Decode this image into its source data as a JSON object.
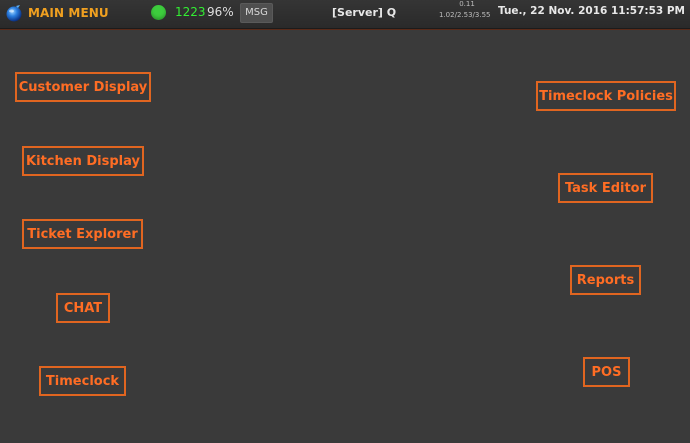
{
  "header": {
    "menu_title": "MAIN MENU",
    "count": "1223",
    "percent": "96%",
    "msg_label": "MSG",
    "server": "[Server] Q",
    "load_top": "0.11",
    "load_bottom": "1.02/2.53/3.55",
    "datetime": "Tue., 22 Nov. 2016 11:57:53 PM",
    "status_color": "#3dcc3d"
  },
  "buttons": {
    "customer_display": "Customer Display",
    "kitchen_display": "Kitchen Display",
    "ticket_explorer": "Ticket Explorer",
    "chat": "CHAT",
    "timeclock": "Timeclock",
    "timeclock_policies": "Timeclock Policies",
    "task_editor": "Task Editor",
    "reports": "Reports",
    "pos": "POS"
  },
  "colors": {
    "accent": "#ff6d24",
    "title": "#f0a020",
    "background": "#3a3a3a"
  }
}
